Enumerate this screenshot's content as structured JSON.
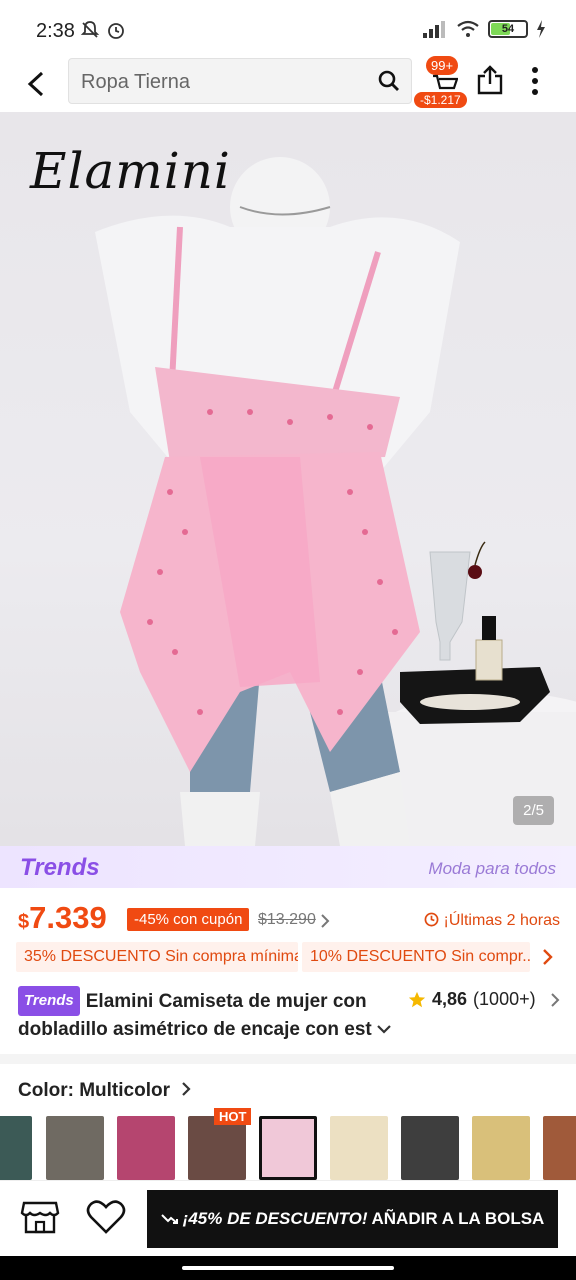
{
  "status_bar": {
    "time": "2:38",
    "battery": "54"
  },
  "header": {
    "search_placeholder": "Ropa Tierna",
    "cart_count": "99+",
    "cart_total": "-$1.217",
    "icons": [
      "back-arrow-icon",
      "search-icon",
      "cart-icon",
      "share-icon",
      "more-icon"
    ]
  },
  "gallery": {
    "brand": "Elamini",
    "counter": "2/5"
  },
  "trends": {
    "logo": "Trends",
    "tagline": "Moda para todos"
  },
  "price": {
    "currency": "$",
    "amount": "7.339",
    "discount": "-45% con cupón",
    "original": "$13.290",
    "timer": "¡Últimas 2 horas"
  },
  "coupons": [
    "35% DESCUENTO Sin compra mínima",
    "10% DESCUENTO Sin compr..."
  ],
  "product": {
    "badge": "Trends",
    "title": "Elamini Camiseta de mujer con dobladillo asimétrico de encaje con est",
    "rating": "4,86",
    "reviews": "(1000+)"
  },
  "color": {
    "label": "Color: Multicolor",
    "hot": "HOT",
    "swatches": [
      "#3c5a56",
      "#6f6a62",
      "#b5456f",
      "#6a4b44",
      "#f0c8d8",
      "#ece0c2",
      "#3e3e3e",
      "#d9c07a",
      "#a05a3a"
    ]
  },
  "bottom": {
    "promo": "¡45% DE DESCUENTO!",
    "action": "AÑADIR A LA BOLSA"
  },
  "colors": {
    "accent": "#f04a12",
    "trends": "#8a4fe6"
  }
}
